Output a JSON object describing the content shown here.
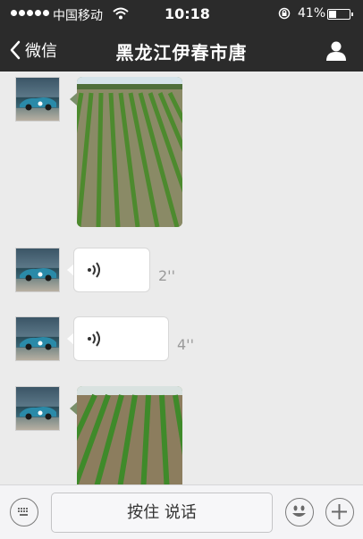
{
  "status_bar": {
    "carrier": "中国移动",
    "time": "10:18",
    "battery": "41%",
    "battery_level": 0.41
  },
  "nav": {
    "back_label": "微信",
    "title": "黑龙江伊春市唐"
  },
  "messages": [
    {
      "type": "image",
      "description_icon": "field-photo"
    },
    {
      "type": "voice",
      "duration": "2''"
    },
    {
      "type": "voice",
      "duration": "4''"
    },
    {
      "type": "image",
      "description_icon": "field-photo"
    }
  ],
  "input_bar": {
    "talk_label": "按住 说话"
  },
  "colors": {
    "nav_bg": "#2b2b2b",
    "chat_bg": "#ebebeb",
    "bubble_bg": "#ffffff",
    "duration_text": "#9a9a9a"
  }
}
